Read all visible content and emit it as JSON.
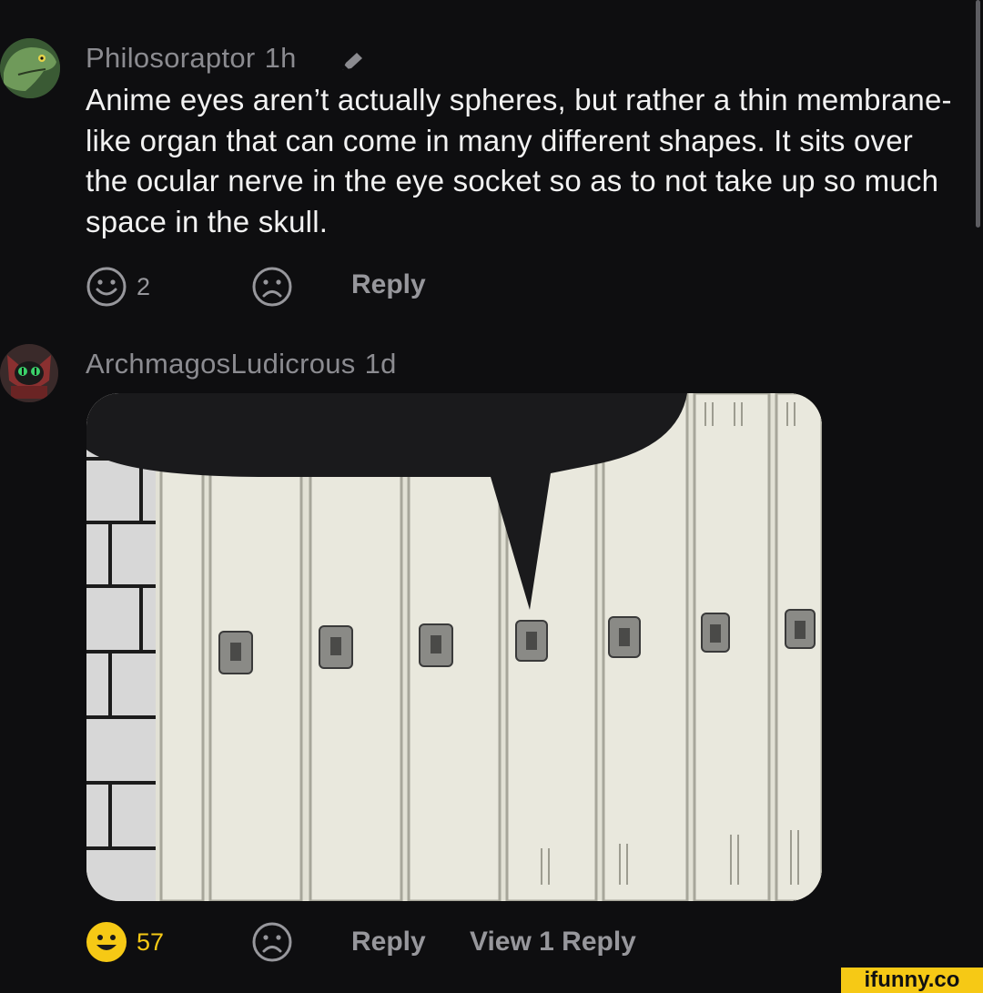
{
  "comments": [
    {
      "username": "Philosoraptor",
      "time": "1h",
      "text": "Anime eyes aren’t actually spheres, but rather a thin membrane-like organ that can come in many different shapes. It sits over the ocular nerve in the eye socket so as to not take up so much space in the skull.",
      "smile_count": "2",
      "reply_label": "Reply",
      "avatar_icon": "dinosaur-avatar-icon",
      "edit_icon": "pencil-icon"
    },
    {
      "username": "ArchmagosLudicrous",
      "time": "1d",
      "smile_count": "57",
      "reply_label": "Reply",
      "view_replies_label": "View 1 Reply",
      "avatar_icon": "cat-avatar-icon",
      "image": "speech-bubble-over-school-lockers"
    }
  ],
  "watermark": "ifunny.co",
  "colors": {
    "background": "#0e0e10",
    "username": "#8b8b90",
    "text": "#f2f2f2",
    "muted_action": "#97979c",
    "active_smile": "#f6c915"
  }
}
